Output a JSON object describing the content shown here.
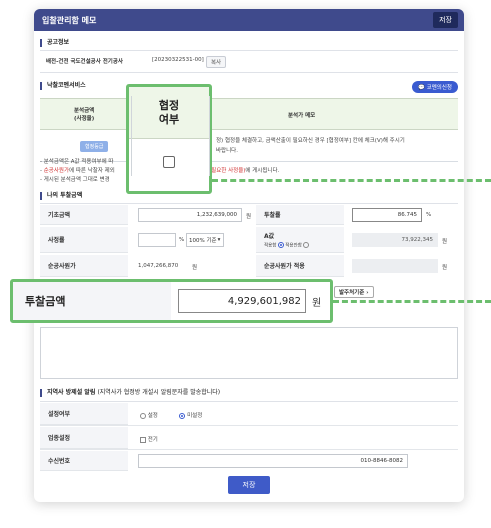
{
  "window": {
    "title": "입찰관리함 메모",
    "save_label": "저장"
  },
  "announce": {
    "section": "공고정보",
    "title": "배전-건전 국도건설공사 전기공사",
    "number": "[20230322531-00]",
    "copy_label": "복사"
  },
  "nak": {
    "section": "낙찰코멘서비스",
    "consult_label": "코멘의신청",
    "col_amount": "분석금액\n(사정율)",
    "col_consult": "협정\n여부",
    "col_memo": "분석가 메모",
    "amount_button": "협정등급",
    "memo_text": "정) 협정을 체결하고, 금액산출이 필요하신 경우 [협정여부] 칸에 체크(V)해 주시기",
    "memo_text2": "바랍니다."
  },
  "notes": {
    "line1": "- 분석금액은 A값 적용여부에 따",
    "line2_prefix": "- ",
    "line2_red": "순공사원가",
    "line2_suffix": "에 따른 낙찰자 제외",
    "line2_right_red": "(필요한 사정율)",
    "line2_right": "에 게시됩니다.",
    "line3": "- 게시된 분석금액 그대로 변경"
  },
  "bid": {
    "section": "나의 투찰금액",
    "base_label": "기초금액",
    "base_value": "1,232,639,000",
    "unit": "원",
    "rate_label": "투찰률",
    "rate_value": "86.745",
    "rate_unit": "%",
    "assess_label": "사정률",
    "assess_unit": "%",
    "assess_select": "100% 기준",
    "a_label": "A값",
    "a_opt1": "적용함",
    "a_opt2": "적용안함",
    "a_value": "73,922,345",
    "net_label": "순공사원가",
    "net_value": "1,047,266,870",
    "net_apply_label": "순공사원가 적용",
    "order_button": "발주처기준"
  },
  "alert": {
    "section": "지역사 방제설 알림",
    "section_note": "(지역사가 협정방 개설시 알림문자를 발송합니다)",
    "setting_label": "설정여부",
    "opt_on": "설정",
    "opt_off": "미설정",
    "biz_label": "업종설정",
    "biz_all": "전기",
    "phone_label": "수신번호",
    "phone_value": "010-8846-8082"
  },
  "footer": {
    "save_label": "저장"
  },
  "zoom_consult": {
    "heading": "협정\n여부"
  },
  "zoom_bid": {
    "label": "투찰금액",
    "value": "4,929,601,982",
    "unit": "원"
  }
}
